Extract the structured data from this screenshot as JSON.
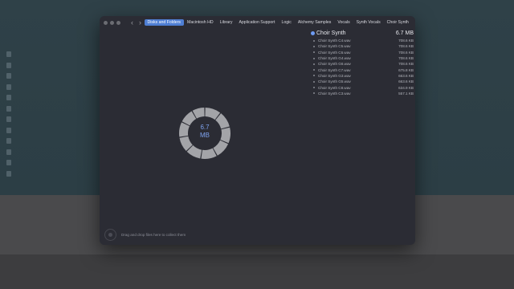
{
  "desktop": {
    "files": [
      "",
      "",
      "",
      "",
      "",
      "",
      "",
      "",
      "",
      "",
      "",
      ""
    ]
  },
  "window": {
    "nav": {
      "back": "‹",
      "forward": "›"
    },
    "breadcrumbs": [
      "Disks and Folders",
      "Macintosh HD",
      "Library",
      "Application Support",
      "Logic",
      "Alchemy Samples",
      "Vocals",
      "Synth Vocals",
      "Choir Synth"
    ],
    "active_crumb": 0,
    "folder": {
      "name": "Choir Synth",
      "size": "6.7 MB",
      "color": "#6e9bf2"
    },
    "files": [
      {
        "name": "Choir Synth C4.wav",
        "size": "708.6 KB"
      },
      {
        "name": "Choir Synth C5.wav",
        "size": "708.6 KB"
      },
      {
        "name": "Choir Synth C6.wav",
        "size": "708.6 KB"
      },
      {
        "name": "Choir Synth G4.wav",
        "size": "708.6 KB"
      },
      {
        "name": "Choir Synth G6.wav",
        "size": "708.6 KB"
      },
      {
        "name": "Choir Synth C7.wav",
        "size": "675.8 KB"
      },
      {
        "name": "Choir Synth G3.wav",
        "size": "663.6 KB"
      },
      {
        "name": "Choir Synth G5.wav",
        "size": "663.6 KB"
      },
      {
        "name": "Choir Synth C8.wav",
        "size": "634.9 KB"
      },
      {
        "name": "Choir Synth C3.wav",
        "size": "557.1 KB"
      }
    ],
    "chart": {
      "total_value": "6.7",
      "total_unit": "MB",
      "ring_color": "#a3a4a8",
      "label_color": "#7ea2ee",
      "segments_kb": [
        708.6,
        708.6,
        708.6,
        708.6,
        708.6,
        675.8,
        663.6,
        663.6,
        634.9,
        557.1
      ]
    },
    "drop_hint": "Drag and drop files here to collect them"
  }
}
